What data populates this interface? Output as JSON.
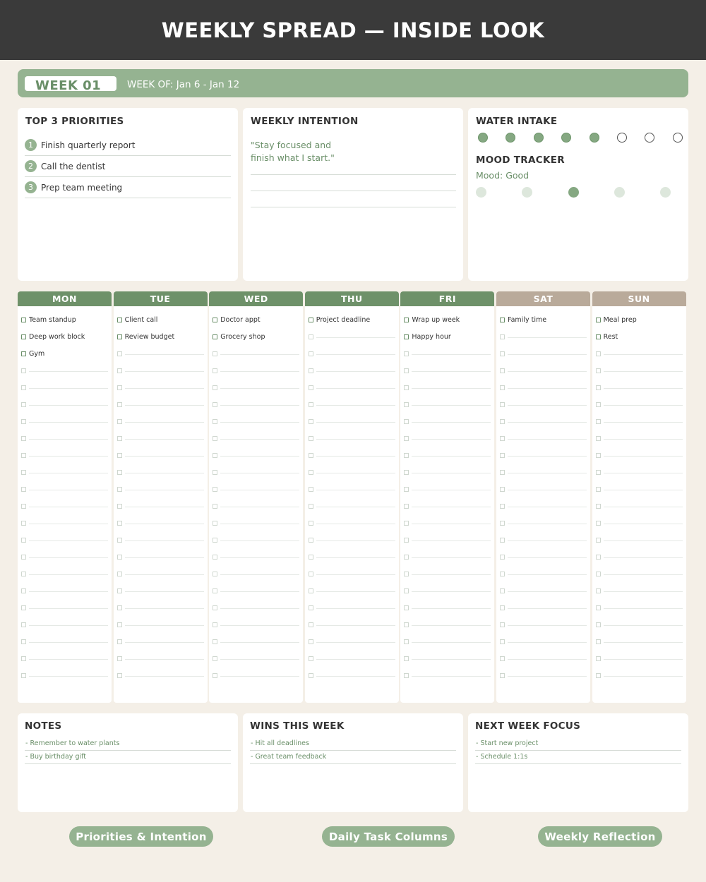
{
  "header": {
    "title": "WEEKLY SPREAD — INSIDE LOOK"
  },
  "week": {
    "badge": "WEEK 01",
    "range": "WEEK OF: Jan 6 - Jan 12"
  },
  "priorities": {
    "title": "TOP 3 PRIORITIES",
    "items": [
      {
        "num": "1",
        "text": "Finish quarterly report"
      },
      {
        "num": "2",
        "text": "Call the dentist"
      },
      {
        "num": "3",
        "text": "Prep team meeting"
      }
    ]
  },
  "intention": {
    "title": "WEEKLY INTENTION",
    "line1": "\"Stay focused and",
    "line2": "finish what I start.\""
  },
  "water": {
    "title": "WATER INTAKE",
    "filled": 5,
    "total": 8
  },
  "mood": {
    "title": "MOOD TRACKER",
    "label": "Mood: Good",
    "active_index": 2,
    "total": 5
  },
  "days": [
    {
      "name": "MON",
      "color": "#6e9169",
      "tasks": [
        "Team standup",
        "Deep work block",
        "Gym"
      ]
    },
    {
      "name": "TUE",
      "color": "#6e9169",
      "tasks": [
        "Client call",
        "Review budget"
      ]
    },
    {
      "name": "WED",
      "color": "#6e9169",
      "tasks": [
        "Doctor appt",
        "Grocery shop"
      ]
    },
    {
      "name": "THU",
      "color": "#6e9169",
      "tasks": [
        "Project deadline"
      ]
    },
    {
      "name": "FRI",
      "color": "#6e9169",
      "tasks": [
        "Wrap up week",
        "Happy hour"
      ]
    },
    {
      "name": "SAT",
      "color": "#b9aa9a",
      "tasks": [
        "Family time"
      ]
    },
    {
      "name": "SUN",
      "color": "#b9aa9a",
      "tasks": [
        "Meal prep",
        "Rest"
      ]
    }
  ],
  "notes": {
    "title": "NOTES",
    "items": [
      "- Remember to water plants",
      "- Buy birthday gift"
    ]
  },
  "wins": {
    "title": "WINS THIS WEEK",
    "items": [
      "- Hit all deadlines",
      "- Great team feedback"
    ]
  },
  "next_focus": {
    "title": "NEXT WEEK FOCUS",
    "items": [
      "- Start new project",
      "- Schedule 1:1s"
    ]
  },
  "labels": {
    "priorities_intention": "Priorities & Intention",
    "daily_tasks": "Daily Task Columns",
    "weekly_reflection": "Weekly Reflection"
  },
  "colors": {
    "accent": "#95b391",
    "accent_dark": "#6e9169",
    "weekend": "#b9aa9a",
    "dark": "#3a3a3a",
    "background": "#f4efe7"
  }
}
